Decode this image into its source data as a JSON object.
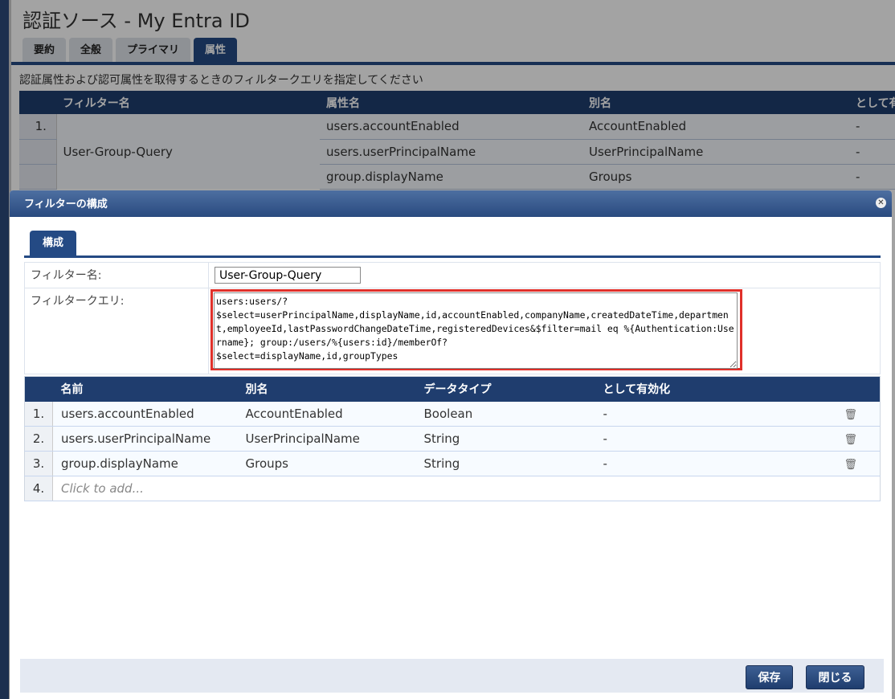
{
  "page": {
    "title": "認証ソース - My Entra ID",
    "tabs": [
      "要約",
      "全般",
      "プライマリ",
      "属性"
    ],
    "active_tab": "属性",
    "instruction": "認証属性および認可属性を取得するときのフィルタークエリを指定してください"
  },
  "bg_table": {
    "headers": [
      "",
      "フィルター名",
      "属性名",
      "別名",
      "として有"
    ],
    "rows": [
      {
        "num": "1.",
        "filter": "",
        "attr": "users.accountEnabled",
        "alias": "AccountEnabled",
        "enabled": "-"
      },
      {
        "num": "",
        "filter": "User-Group-Query",
        "attr": "users.userPrincipalName",
        "alias": "UserPrincipalName",
        "enabled": "-"
      },
      {
        "num": "",
        "filter": "",
        "attr": "group.displayName",
        "alias": "Groups",
        "enabled": "-"
      }
    ]
  },
  "modal": {
    "title": "フィルターの構成",
    "tab": "構成",
    "filter_name_label": "フィルター名:",
    "filter_name_value": "User-Group-Query",
    "filter_query_label": "フィルタークエリ:",
    "filter_query_value": "users:users/?\n$select=userPrincipalName,displayName,id,accountEnabled,companyName,createdDateTime,department,employeeId,lastPasswordChangeDateTime,registeredDevices&$filter=mail eq %{Authentication:Username}; group:/users/%{users:id}/memberOf?\n$select=displayName,id,groupTypes",
    "table": {
      "headers": [
        "",
        "名前",
        "別名",
        "データタイプ",
        "として有効化",
        ""
      ],
      "rows": [
        {
          "num": "1.",
          "name": "users.accountEnabled",
          "alias": "AccountEnabled",
          "type": "Boolean",
          "enabled": "-"
        },
        {
          "num": "2.",
          "name": "users.userPrincipalName",
          "alias": "UserPrincipalName",
          "type": "String",
          "enabled": "-"
        },
        {
          "num": "3.",
          "name": "group.displayName",
          "alias": "Groups",
          "type": "String",
          "enabled": "-"
        }
      ],
      "add_num": "4.",
      "add_placeholder": "Click to add..."
    },
    "save": "保存",
    "close": "閉じる"
  },
  "colors": {
    "header": "#1f3d6e",
    "highlight": "#e0302a"
  }
}
